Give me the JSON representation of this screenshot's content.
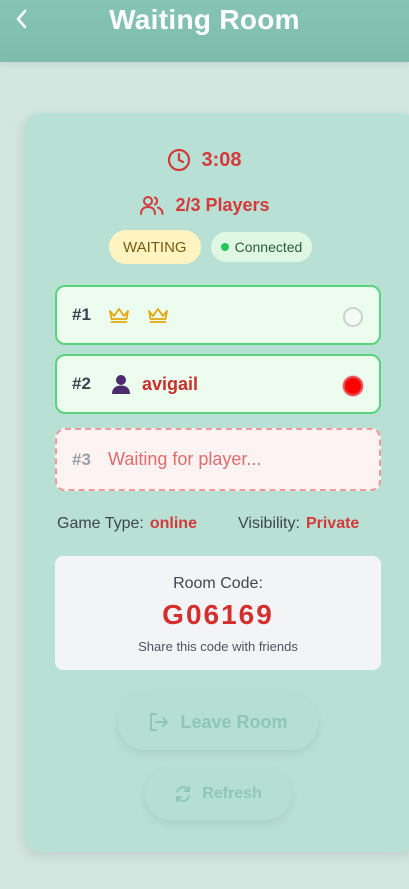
{
  "header": {
    "title": "Waiting Room",
    "back_icon": "chevron-left-icon"
  },
  "timer": {
    "value": "3:08",
    "icon": "clock-icon"
  },
  "players": {
    "label": "2/3 Players",
    "icon": "users-icon"
  },
  "status": {
    "state": "WAITING",
    "connection": "Connected"
  },
  "slots": [
    {
      "num": "#1",
      "name": "",
      "icons": [
        "crown-icon",
        "crown-icon"
      ],
      "ready": false
    },
    {
      "num": "#2",
      "name": "avigail",
      "icons": [
        "user-icon"
      ],
      "ready": true
    },
    {
      "num": "#3",
      "name": "Waiting for player...",
      "empty": true
    }
  ],
  "game_info": {
    "type_label": "Game Type:",
    "type_value": "online",
    "visibility_label": "Visibility:",
    "visibility_value": "Private"
  },
  "room": {
    "label": "Room Code:",
    "code": "G06169",
    "hint": "Share this code with friends"
  },
  "actions": {
    "leave_label": "Leave Room",
    "refresh_label": "Refresh"
  },
  "colors": {
    "accent": "#d33a3a",
    "header": "#7dbcad",
    "card": "#b9e0d5",
    "ready": "#ff0000",
    "connected": "#22c55e"
  }
}
